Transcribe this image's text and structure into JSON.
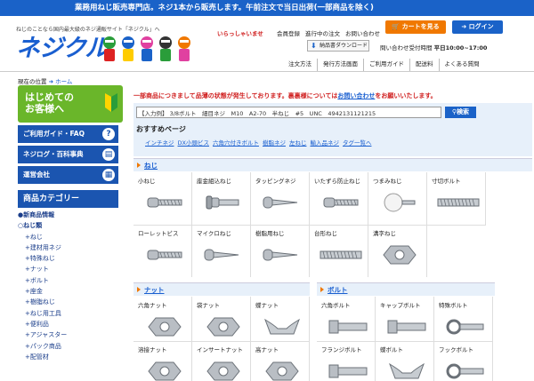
{
  "topbar": {
    "text": "業務用ねじ販売専門店。ネジ1本から販売します。午前注文で当日出荷(一部商品を除く)"
  },
  "header": {
    "tagline": "ねじのことなら国内最大級のネジ通販サイト「ネジクル」へ",
    "logo": "ネジクル",
    "cart_label": "カートを見る",
    "login_label": "ログイン",
    "welcome": "いらっしゃいませ",
    "links": [
      "会員登録",
      "進行中の注文",
      "お問い合わせ"
    ],
    "download_label": "納品書ダウンロード",
    "hours_label": "問い合わせ受付時間",
    "hours_value": "平日10:00~17:00",
    "nav": [
      "注文方法",
      "発行方法画面",
      "ご利用ガイド",
      "配送料",
      "よくある質問"
    ],
    "colors": {
      "primary": "#1a62c8",
      "accent": "#f07800",
      "green": "#6ab62a",
      "alert": "#d02020"
    }
  },
  "breadcrumb": {
    "prefix": "現在の位置",
    "home": "ホーム"
  },
  "sidebar": {
    "guide_line1": "はじめての",
    "guide_line2": "お客様へ",
    "buttons": [
      {
        "label": "ご利用ガイド・FAQ",
        "icon": "help-icon",
        "glyph": "?"
      },
      {
        "label": "ネジログ・百科事典",
        "icon": "book-icon",
        "glyph": "▤"
      },
      {
        "label": "運営会社",
        "icon": "building-icon",
        "glyph": "▦"
      }
    ],
    "category_heading": "商品カテゴリー",
    "items": [
      {
        "label": "●新商品情報",
        "level": "top"
      },
      {
        "label": "○ねじ類",
        "level": "top"
      },
      {
        "label": "+ねじ",
        "level": "sub"
      },
      {
        "label": "+建材用ネジ",
        "level": "sub"
      },
      {
        "label": "+特殊ねじ",
        "level": "sub"
      },
      {
        "label": "+ナット",
        "level": "sub"
      },
      {
        "label": "+ボルト",
        "level": "sub"
      },
      {
        "label": "+座金",
        "level": "sub"
      },
      {
        "label": "+樹脂ねじ",
        "level": "sub"
      },
      {
        "label": "+ねじ用工具",
        "level": "sub"
      },
      {
        "label": "+便利品",
        "level": "sub"
      },
      {
        "label": "+アジャスター",
        "level": "sub"
      },
      {
        "label": "+パック商品",
        "level": "sub"
      },
      {
        "label": "+配管材",
        "level": "sub"
      }
    ]
  },
  "main": {
    "notice_text": "一部商品につきまして品薄の状態が発生しております。裏裏様については",
    "notice_link": "お問い合わせ",
    "notice_tail": "をお願いいたします。",
    "search_value": "【入力例】 3/8ボルト　細目ネジ　M10　A2-70　半ねじ　#5　UNC　4942131121215",
    "search_button": "検索",
    "recommend_title": "おすすめページ",
    "recommend_links": [
      "インチネジ",
      "DX小頭ビス",
      "六角穴付きボルト",
      "樹脂ネジ",
      "左ねじ",
      "輸入品ネジ",
      "タグ一覧へ"
    ],
    "sections": {
      "screws": {
        "title": "ねじ",
        "items": [
          "小ねじ",
          "座金組込ねじ",
          "タッピングネジ",
          "いたずら防止ねじ",
          "つまみねじ",
          "寸切ボルト",
          "ローレットビス",
          "マイクロねじ",
          "樹脂用ねじ",
          "台形ねじ",
          "溝字ねじ"
        ]
      },
      "nuts": {
        "title": "ナット",
        "items": [
          "六角ナット",
          "袋ナット",
          "蝶ナット",
          "溶接ナット",
          "インサートナット",
          "高ナット"
        ]
      },
      "bolts": {
        "title": "ボルト",
        "items": [
          "六角ボルト",
          "キャップボルト",
          "特殊ボルト",
          "フランジボルト",
          "蝶ボルト",
          "フックボルト"
        ]
      }
    }
  }
}
